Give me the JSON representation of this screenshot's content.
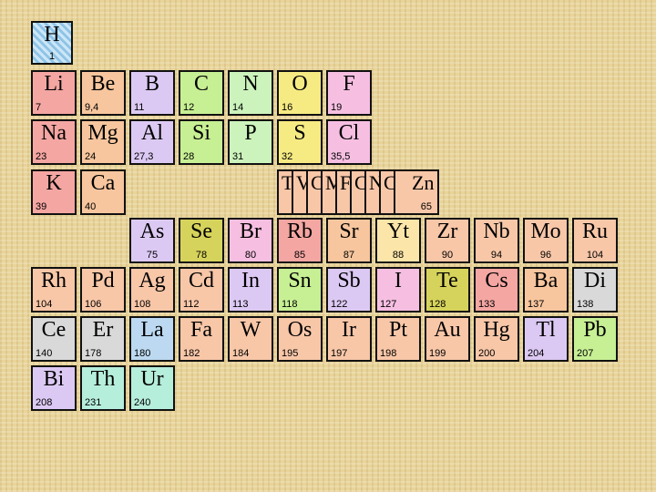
{
  "palette": {
    "accent": "#f4a6a2",
    "background": "#e8d49a"
  },
  "row1": {
    "h": {
      "symbol": "H",
      "mass": "1"
    }
  },
  "row2": [
    {
      "symbol": "Li",
      "mass": "7"
    },
    {
      "symbol": "Be",
      "mass": "9,4"
    },
    {
      "symbol": "B",
      "mass": "11"
    },
    {
      "symbol": "C",
      "mass": "12"
    },
    {
      "symbol": "N",
      "mass": "14"
    },
    {
      "symbol": "O",
      "mass": "16"
    },
    {
      "symbol": "F",
      "mass": "19"
    }
  ],
  "row3": [
    {
      "symbol": "Na",
      "mass": "23"
    },
    {
      "symbol": "Mg",
      "mass": "24"
    },
    {
      "symbol": "Al",
      "mass": "27,3"
    },
    {
      "symbol": "Si",
      "mass": "28"
    },
    {
      "symbol": "P",
      "mass": "31"
    },
    {
      "symbol": "S",
      "mass": "32"
    },
    {
      "symbol": "Cl",
      "mass": "35,5"
    }
  ],
  "row4": [
    {
      "symbol": "K",
      "mass": "39"
    },
    {
      "symbol": "Ca",
      "mass": "40"
    }
  ],
  "strip": {
    "fragments": [
      "T",
      "V",
      "C",
      "M",
      "F",
      "C",
      "N",
      "C"
    ],
    "zn": {
      "symbol": "Zn",
      "mass": "65"
    }
  },
  "row5": [
    {
      "symbol": "As",
      "mass": "75"
    },
    {
      "symbol": "Se",
      "mass": "78"
    },
    {
      "symbol": "Br",
      "mass": "80"
    },
    {
      "symbol": "Rb",
      "mass": "85"
    },
    {
      "symbol": "Sr",
      "mass": "87"
    },
    {
      "symbol": "Yt",
      "mass": "88"
    },
    {
      "symbol": "Zr",
      "mass": "90"
    },
    {
      "symbol": "Nb",
      "mass": "94"
    },
    {
      "symbol": "Mo",
      "mass": "96"
    },
    {
      "symbol": "Ru",
      "mass": "104"
    }
  ],
  "row6": [
    {
      "symbol": "Rh",
      "mass": "104"
    },
    {
      "symbol": "Pd",
      "mass": "106"
    },
    {
      "symbol": "Ag",
      "mass": "108"
    },
    {
      "symbol": "Cd",
      "mass": "112"
    },
    {
      "symbol": "In",
      "mass": "113"
    },
    {
      "symbol": "Sn",
      "mass": "118"
    },
    {
      "symbol": "Sb",
      "mass": "122"
    },
    {
      "symbol": "I",
      "mass": "127"
    },
    {
      "symbol": "Te",
      "mass": "128"
    },
    {
      "symbol": "Cs",
      "mass": "133"
    },
    {
      "symbol": "Ba",
      "mass": "137"
    },
    {
      "symbol": "Di",
      "mass": "138"
    }
  ],
  "row7": [
    {
      "symbol": "Ce",
      "mass": "140"
    },
    {
      "symbol": "Er",
      "mass": "178"
    },
    {
      "symbol": "La",
      "mass": "180"
    },
    {
      "symbol": "Fa",
      "mass": "182"
    },
    {
      "symbol": "W",
      "mass": "184"
    },
    {
      "symbol": "Os",
      "mass": "195"
    },
    {
      "symbol": "Ir",
      "mass": "197"
    },
    {
      "symbol": "Pt",
      "mass": "198"
    },
    {
      "symbol": "Au",
      "mass": "199"
    },
    {
      "symbol": "Hg",
      "mass": "200"
    },
    {
      "symbol": "Tl",
      "mass": "204"
    },
    {
      "symbol": "Pb",
      "mass": "207"
    }
  ],
  "row8": [
    {
      "symbol": "Bi",
      "mass": "208"
    },
    {
      "symbol": "Th",
      "mass": "231"
    },
    {
      "symbol": "Ur",
      "mass": "240"
    }
  ]
}
